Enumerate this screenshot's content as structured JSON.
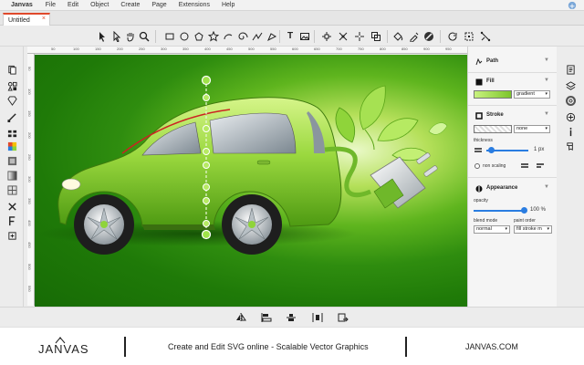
{
  "app": {
    "brand": "Janvas",
    "menu": [
      "File",
      "Edit",
      "Object",
      "Create",
      "Page",
      "Extensions",
      "Help"
    ]
  },
  "tabs": [
    {
      "label": "Untitled",
      "close": "×"
    }
  ],
  "ruler": {
    "top_ticks": [
      "10",
      "50",
      "100",
      "150",
      "200",
      "250",
      "300",
      "350",
      "400",
      "450",
      "500",
      "550",
      "600",
      "650",
      "700",
      "750",
      "800",
      "850",
      "900",
      "950"
    ],
    "left_ticks": [
      "50",
      "100",
      "150",
      "200",
      "250",
      "300",
      "350",
      "400",
      "450",
      "500",
      "550"
    ]
  },
  "panel": {
    "path": {
      "title": "Path"
    },
    "fill": {
      "title": "Fill",
      "type": "gradient",
      "swatch_color": "#8fd43a"
    },
    "stroke": {
      "title": "Stroke",
      "type": "none",
      "thickness_label": "thickness",
      "thickness_value": "1 px",
      "non_scaling_label": "non scaling"
    },
    "appearance": {
      "title": "Appearance",
      "opacity_label": "opacity",
      "opacity_value": "100 %",
      "opacity": 1.0,
      "blend_label": "blend mode",
      "blend_value": "normal",
      "paint_label": "paint order",
      "paint_value": "fill stroke m"
    }
  },
  "footer": {
    "logo": "JANVAS",
    "tagline": "Create and Edit SVG online - Scalable Vector Graphics",
    "site": "JANVAS.COM"
  },
  "colors": {
    "accent": "#e0492b",
    "car_green": "#8fd43a",
    "slider_blue": "#2a7de1",
    "canvas_dark": "#1f7a08"
  }
}
